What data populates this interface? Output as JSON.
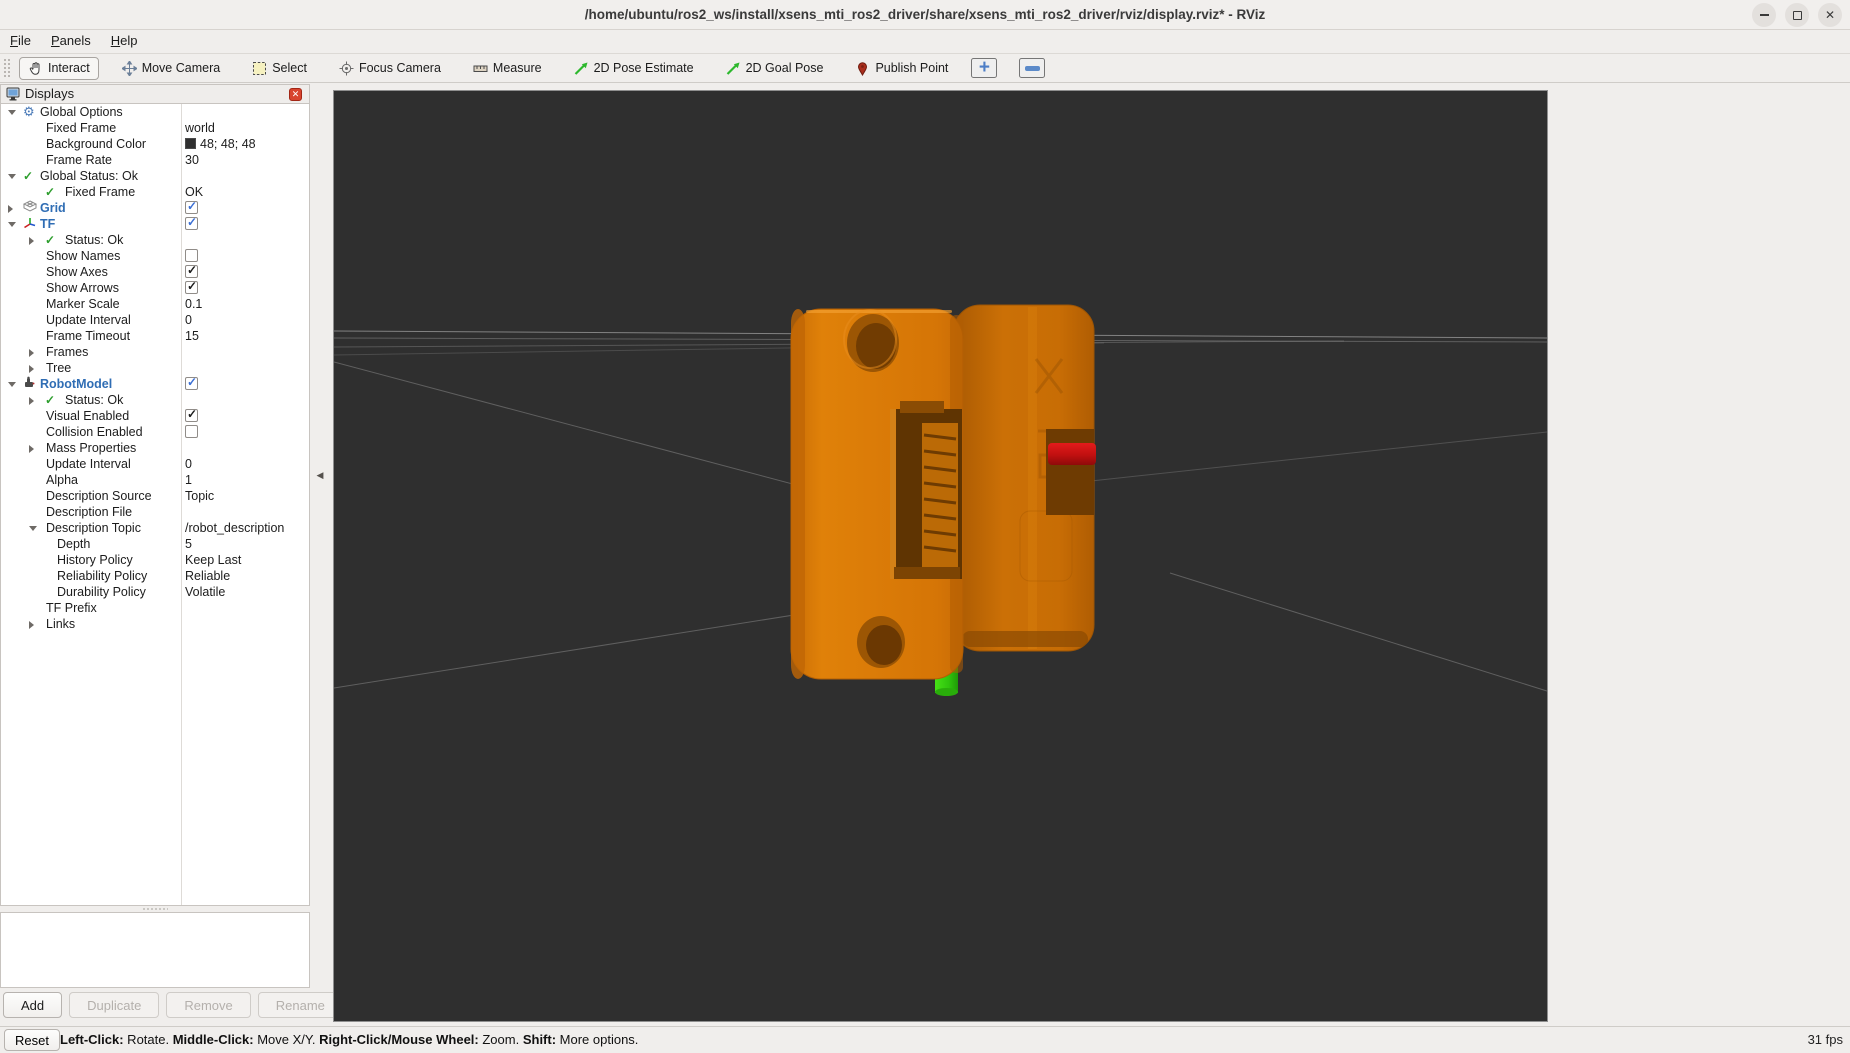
{
  "window": {
    "title": "/home/ubuntu/ros2_ws/install/xsens_mti_ros2_driver/share/xsens_mti_ros2_driver/rviz/display.rviz* - RViz",
    "controls": [
      "minimize",
      "maximize",
      "close"
    ]
  },
  "menubar": {
    "items": [
      {
        "label": "File"
      },
      {
        "label": "Panels"
      },
      {
        "label": "Help"
      }
    ]
  },
  "toolbar": {
    "tools": [
      {
        "label": "Interact",
        "icon": "interact-hand",
        "active": true
      },
      {
        "label": "Move Camera",
        "icon": "move-camera",
        "active": false
      },
      {
        "label": "Select",
        "icon": "select-box",
        "active": false
      },
      {
        "label": "Focus Camera",
        "icon": "focus-camera",
        "active": false
      },
      {
        "label": "Measure",
        "icon": "measure-ruler",
        "active": false
      },
      {
        "label": "2D Pose Estimate",
        "icon": "green-arrow",
        "active": false
      },
      {
        "label": "2D Goal Pose",
        "icon": "green-arrow",
        "active": false
      },
      {
        "label": "Publish Point",
        "icon": "publish-pin",
        "active": false
      }
    ],
    "zoom_in_label": "+",
    "zoom_out_label": "minus"
  },
  "displays": {
    "title": "Displays",
    "rows": [
      {
        "label": "Global Options",
        "level": 0,
        "expander": "open",
        "icon": "gear",
        "vtype": "none"
      },
      {
        "label": "Fixed Frame",
        "level": 1,
        "value": "world",
        "vtype": "text"
      },
      {
        "label": "Background Color",
        "level": 1,
        "value": "48; 48; 48",
        "vtype": "swatch"
      },
      {
        "label": "Frame Rate",
        "level": 1,
        "value": "30",
        "vtype": "text"
      },
      {
        "label": "Global Status: Ok",
        "level": 0,
        "expander": "open",
        "icon": "check",
        "vtype": "none"
      },
      {
        "label": "Fixed Frame",
        "level": 1,
        "icon": "check",
        "value": "OK",
        "vtype": "text"
      },
      {
        "label": "Grid",
        "level": 0,
        "expander": "closed",
        "icon": "grid",
        "blue": true,
        "vtype": "cb_blue"
      },
      {
        "label": "TF",
        "level": 0,
        "expander": "open",
        "icon": "tf",
        "blue": true,
        "vtype": "cb_blue"
      },
      {
        "label": "Status: Ok",
        "level": 1,
        "expander": "closed",
        "icon": "check",
        "vtype": "none"
      },
      {
        "label": "Show Names",
        "level": 1,
        "vtype": "cb_empty"
      },
      {
        "label": "Show Axes",
        "level": 1,
        "vtype": "cb_check"
      },
      {
        "label": "Show Arrows",
        "level": 1,
        "vtype": "cb_check"
      },
      {
        "label": "Marker Scale",
        "level": 1,
        "value": "0.1",
        "vtype": "text"
      },
      {
        "label": "Update Interval",
        "level": 1,
        "value": "0",
        "vtype": "text"
      },
      {
        "label": "Frame Timeout",
        "level": 1,
        "value": "15",
        "vtype": "text"
      },
      {
        "label": "Frames",
        "level": 1,
        "expander": "closed",
        "vtype": "none"
      },
      {
        "label": "Tree",
        "level": 1,
        "expander": "closed",
        "vtype": "none"
      },
      {
        "label": "RobotModel",
        "level": 0,
        "expander": "open",
        "icon": "robot",
        "blue": true,
        "vtype": "cb_blue"
      },
      {
        "label": "Status: Ok",
        "level": 1,
        "expander": "closed",
        "icon": "check",
        "vtype": "none"
      },
      {
        "label": "Visual Enabled",
        "level": 1,
        "vtype": "cb_check"
      },
      {
        "label": "Collision Enabled",
        "level": 1,
        "vtype": "cb_empty"
      },
      {
        "label": "Mass Properties",
        "level": 1,
        "expander": "closed",
        "vtype": "none"
      },
      {
        "label": "Update Interval",
        "level": 1,
        "value": "0",
        "vtype": "text"
      },
      {
        "label": "Alpha",
        "level": 1,
        "value": "1",
        "vtype": "text"
      },
      {
        "label": "Description Source",
        "level": 1,
        "value": "Topic",
        "vtype": "text"
      },
      {
        "label": "Description File",
        "level": 1,
        "value": "",
        "vtype": "text"
      },
      {
        "label": "Description Topic",
        "level": 1,
        "expander": "open",
        "value": "/robot_description",
        "vtype": "text"
      },
      {
        "label": "Depth",
        "level": 2,
        "value": "5",
        "vtype": "text"
      },
      {
        "label": "History Policy",
        "level": 2,
        "value": "Keep Last",
        "vtype": "text"
      },
      {
        "label": "Reliability Policy",
        "level": 2,
        "value": "Reliable",
        "vtype": "text"
      },
      {
        "label": "Durability Policy",
        "level": 2,
        "value": "Volatile",
        "vtype": "text"
      },
      {
        "label": "TF Prefix",
        "level": 1,
        "value": "",
        "vtype": "text"
      },
      {
        "label": "Links",
        "level": 1,
        "expander": "closed",
        "vtype": "none"
      }
    ],
    "buttons": [
      {
        "label": "Add",
        "enabled": true
      },
      {
        "label": "Duplicate",
        "enabled": false
      },
      {
        "label": "Remove",
        "enabled": false
      },
      {
        "label": "Rename",
        "enabled": false
      }
    ]
  },
  "statusbar": {
    "reset_label": "Reset",
    "help": [
      {
        "b": "Left-Click:",
        "t": " Rotate. "
      },
      {
        "b": "Middle-Click:",
        "t": " Move X/Y. "
      },
      {
        "b": "Right-Click/Mouse Wheel:",
        "t": " Zoom. "
      },
      {
        "b": "Shift:",
        "t": " More options."
      }
    ],
    "fps": "31 fps"
  },
  "colors": {
    "viewport_background": "#2f2f2f",
    "background_color_value": "48; 48; 48",
    "model_orange": "#d97807",
    "connector_red": "#d11212",
    "axis_green": "#35d60e",
    "accent_blue": "#2f6db4"
  }
}
